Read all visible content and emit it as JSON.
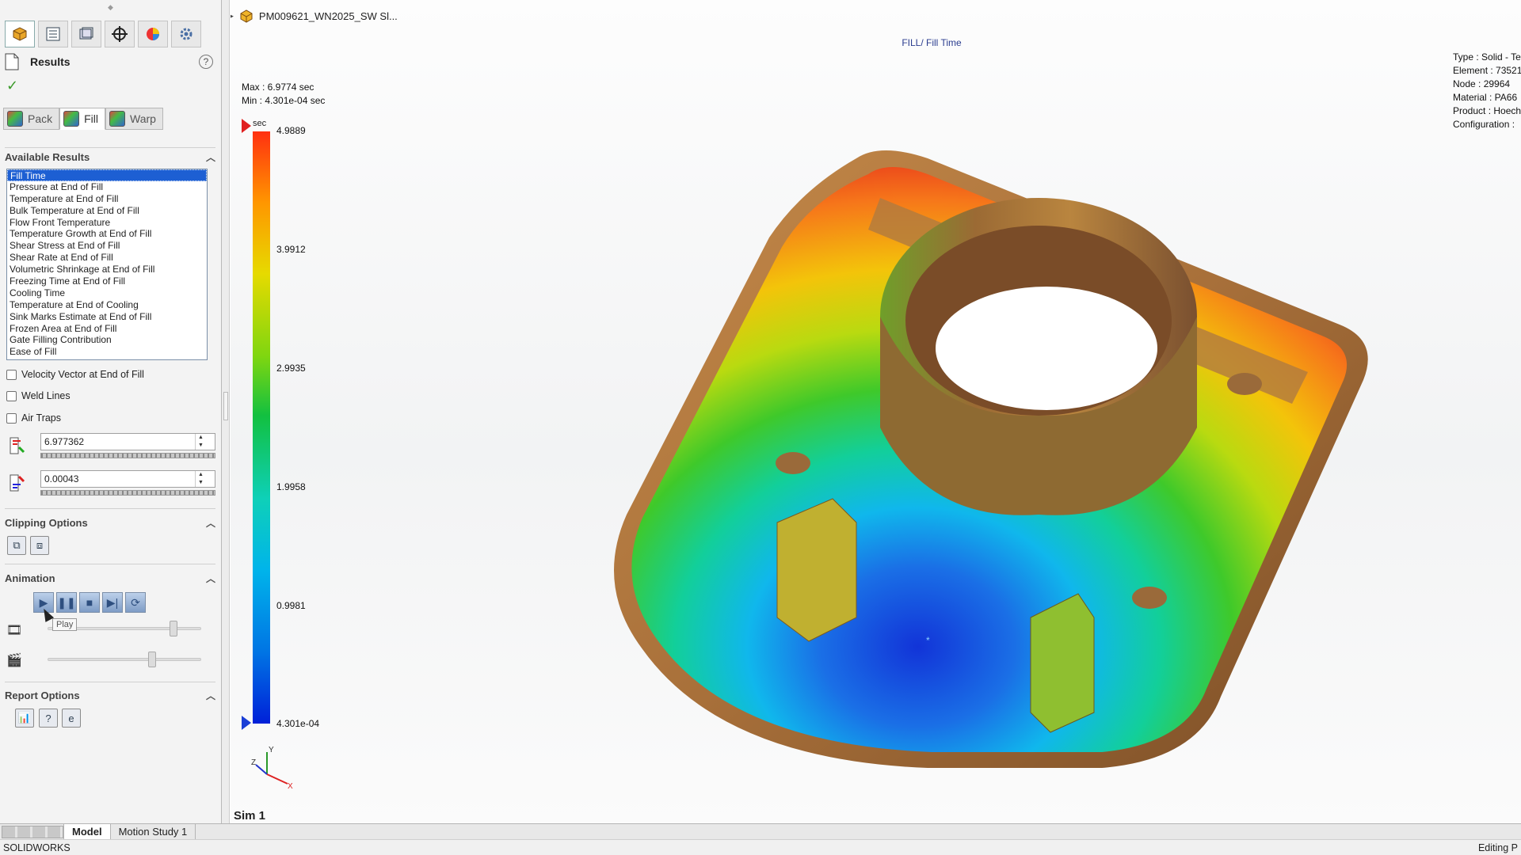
{
  "app": {
    "name": "SOLIDWORKS",
    "status_right": "Editing P"
  },
  "tree": {
    "part_name": "PM009621_WN2025_SW Sl..."
  },
  "panel": {
    "title": "Results",
    "help": "?",
    "confirm": "✓",
    "mode_tabs": [
      {
        "label": "Pack",
        "active": false
      },
      {
        "label": "Fill",
        "active": true
      },
      {
        "label": "Warp",
        "active": false
      }
    ],
    "available_results": {
      "heading": "Available Results",
      "selected": "Fill Time",
      "items": [
        "Fill Time",
        "Pressure at End of Fill",
        "Temperature at End of Fill",
        "Bulk Temperature at End of Fill",
        "Flow Front Temperature",
        "Temperature Growth at End of Fill",
        "Shear Stress at End of Fill",
        "Shear Rate at End of Fill",
        "Volumetric Shrinkage at End of Fill",
        "Freezing Time at End of Fill",
        "Cooling Time",
        "Temperature at End of Cooling",
        "Sink Marks Estimate at End of Fill",
        "Frozen Area at End of Fill",
        "Gate Filling Contribution",
        "Ease of Fill"
      ]
    },
    "checkboxes": [
      {
        "label": "Velocity Vector at End of Fill",
        "checked": false
      },
      {
        "label": "Weld Lines",
        "checked": false
      },
      {
        "label": "Air Traps",
        "checked": false
      }
    ],
    "max_value": "6.977362",
    "min_value": "0.00043",
    "clipping": {
      "heading": "Clipping Options"
    },
    "animation": {
      "heading": "Animation",
      "tooltip": "Play"
    },
    "report": {
      "heading": "Report Options"
    }
  },
  "viewport": {
    "plot_title": "FILL/ Fill Time",
    "max_text": "Max : 6.9774 sec",
    "min_text": "Min : 4.301e-04 sec",
    "info": [
      "Type : Solid - Te",
      "Element : 73521",
      "Node : 29964",
      "Material : PA66",
      "Product : Hoech",
      "Configuration : "
    ],
    "legend": {
      "unit": "sec",
      "ticks": [
        "4.9889",
        "3.9912",
        "2.9935",
        "1.9958",
        "0.9981",
        "4.301e-04"
      ]
    },
    "triad": {
      "x": "X",
      "y": "Y",
      "z": "Z"
    },
    "sim_label": "Sim 1"
  },
  "bottom_tabs": [
    {
      "label": "Model",
      "active": true
    },
    {
      "label": "Motion Study 1",
      "active": false
    }
  ]
}
